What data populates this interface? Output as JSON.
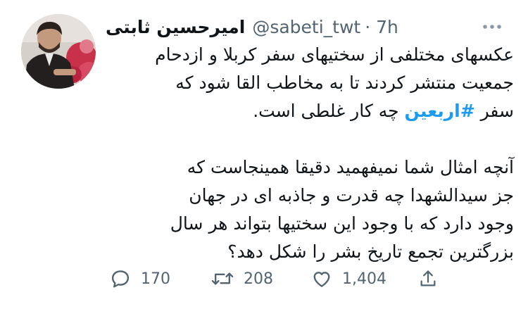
{
  "author": {
    "display_name": "امیرحسین ثابتی",
    "handle": "@sabeti_twt",
    "time": "· 7h"
  },
  "tweet": {
    "paragraph1": [
      "عکسهای مختلفی از سختیهای سفر کربلا و ازدحام",
      "جمعیت منتشر کردند تا به مخاطب القا شود که"
    ],
    "line3_prefix": "سفر ",
    "hashtag": "#اربعین",
    "line3_suffix": " چه کار غلطی است.",
    "paragraph2": [
      "آنچه امثال شما نمیفهمید دقیقا همینجاست که",
      "جز سیدالشهدا چه قدرت و جاذبه ای در جهان",
      "وجود دارد که با وجود این سختیها بتواند هر سال",
      "بزرگترین تجمع تاریخ بشر را شکل دهد؟"
    ]
  },
  "actions": {
    "reply_count": "170",
    "retweet_count": "208",
    "like_count": "1,404"
  },
  "colors": {
    "text": "#0f1419",
    "muted": "#536471",
    "hashtag": "#1d9bf0"
  },
  "icons": [
    "avatar",
    "more-icon",
    "reply-icon",
    "retweet-icon",
    "like-icon",
    "share-icon"
  ]
}
